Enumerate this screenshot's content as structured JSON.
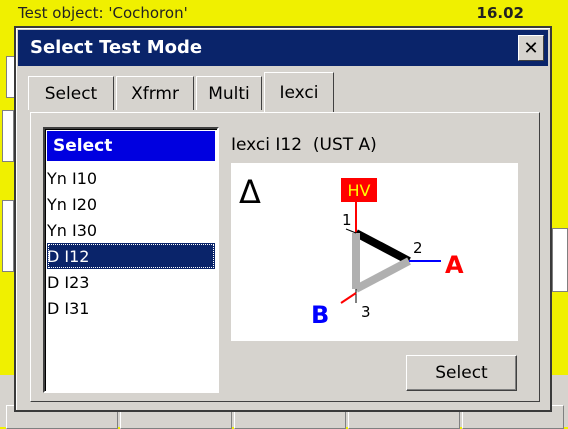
{
  "background": {
    "title": "Test object: 'Cochoron'",
    "title_value": "16.02"
  },
  "dialog": {
    "title": "Select Test Mode",
    "close_glyph": "✕",
    "tabs": [
      {
        "label": "Select",
        "active": false
      },
      {
        "label": "Xfrmr",
        "active": false
      },
      {
        "label": "Multi",
        "active": false
      },
      {
        "label": "Iexci",
        "active": true
      }
    ],
    "list": {
      "header": "Select",
      "items": [
        "Yn I10",
        "Yn I20",
        "Yn I30",
        "D I12",
        "D I23",
        "D I31"
      ],
      "selected_index": 3
    },
    "mode_label": "Iexci I12  (UST A)",
    "diagram": {
      "symbol": "Δ",
      "hv_label": "HV",
      "node_1": "1",
      "node_2": "2",
      "node_3": "3",
      "label_a": "A",
      "label_b": "B",
      "colors": {
        "hv_bg": "#ff0000",
        "a": "#ff0000",
        "b": "#0000ff",
        "active_winding": "#000000",
        "inactive_winding": "#b0b0b0"
      }
    },
    "select_button": "Select"
  },
  "colors": {
    "title_bar": "#0a246a",
    "list_header": "#0000e0",
    "app_background": "#f0f000"
  }
}
